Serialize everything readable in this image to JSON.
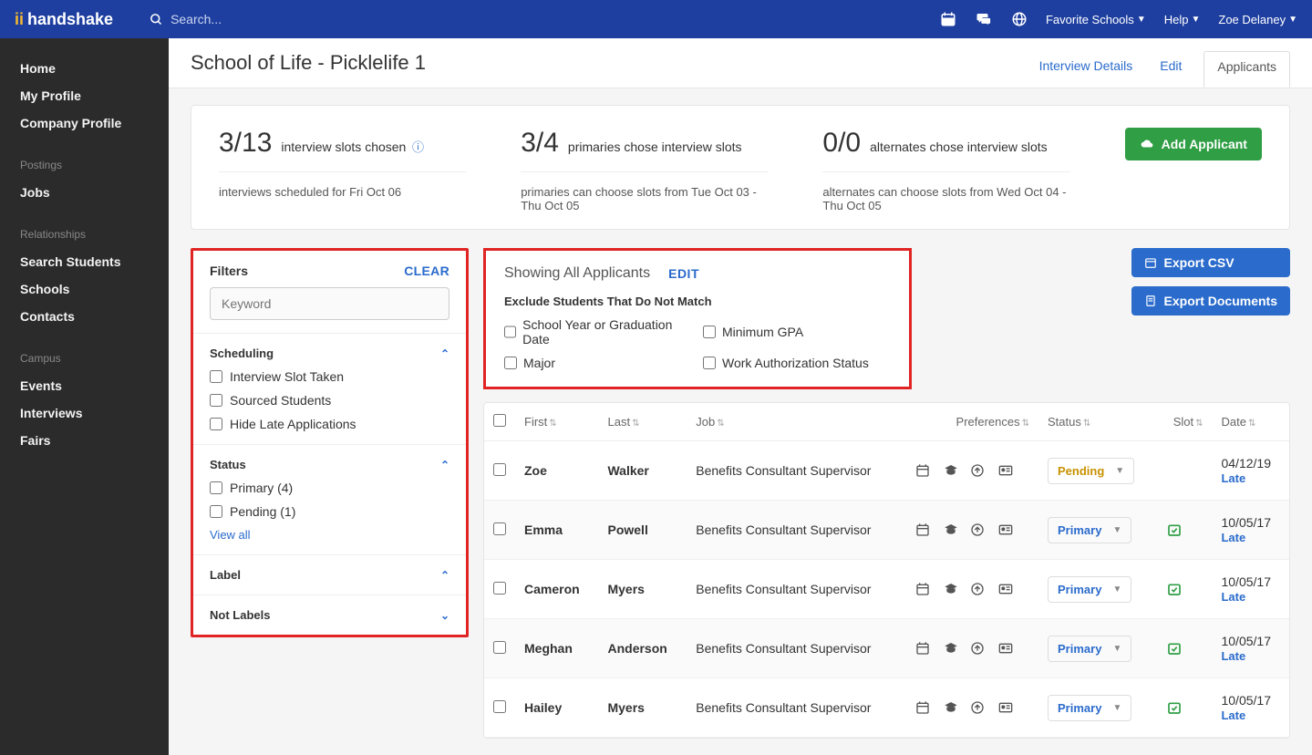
{
  "brand": {
    "name": "handshake"
  },
  "search": {
    "placeholder": "Search..."
  },
  "topnav": {
    "favorite_schools": "Favorite Schools",
    "help": "Help",
    "user": "Zoe Delaney"
  },
  "sidebar": {
    "groups": [
      {
        "title": null,
        "items": [
          "Home",
          "My Profile",
          "Company Profile"
        ]
      },
      {
        "title": "Postings",
        "items": [
          "Jobs"
        ]
      },
      {
        "title": "Relationships",
        "items": [
          "Search Students",
          "Schools",
          "Contacts"
        ]
      },
      {
        "title": "Campus",
        "items": [
          "Events",
          "Interviews",
          "Fairs"
        ]
      }
    ]
  },
  "page": {
    "title": "School of Life - Picklelife 1",
    "tabs": [
      "Interview Details",
      "Edit",
      "Applicants"
    ],
    "active_tab": 2
  },
  "stats": [
    {
      "num": "3/13",
      "label": "interview slots chosen",
      "info": true,
      "sub": "interviews scheduled for Fri Oct 06"
    },
    {
      "num": "3/4",
      "label": "primaries chose interview slots",
      "info": false,
      "sub": "primaries can choose slots from Tue Oct 03 - Thu Oct 05"
    },
    {
      "num": "0/0",
      "label": "alternates chose interview slots",
      "info": false,
      "sub": "alternates can choose slots from Wed Oct 04 - Thu Oct 05"
    }
  ],
  "add_applicant_label": "Add Applicant",
  "filters": {
    "title": "Filters",
    "clear": "CLEAR",
    "keyword_placeholder": "Keyword",
    "sections": {
      "scheduling": {
        "title": "Scheduling",
        "opts": [
          "Interview Slot Taken",
          "Sourced Students",
          "Hide Late Applications"
        ]
      },
      "status": {
        "title": "Status",
        "opts": [
          "Primary (4)",
          "Pending (1)"
        ],
        "view_all": "View all"
      },
      "label": {
        "title": "Label"
      },
      "not_labels": {
        "title": "Not Labels"
      }
    }
  },
  "applicants_filter": {
    "showing": "Showing All Applicants",
    "edit": "EDIT",
    "exclude_title": "Exclude Students That Do Not Match",
    "opts": [
      "School Year or Graduation Date",
      "Minimum GPA",
      "Major",
      "Work Authorization Status"
    ]
  },
  "export": {
    "csv": "Export CSV",
    "docs": "Export Documents"
  },
  "table": {
    "headers": {
      "first": "First",
      "last": "Last",
      "job": "Job",
      "prefs": "Preferences",
      "status": "Status",
      "slot": "Slot",
      "date": "Date"
    },
    "rows": [
      {
        "first": "Zoe",
        "last": "Walker",
        "job": "Benefits Consultant Supervisor",
        "status": "Pending",
        "status_class": "pending",
        "slot": false,
        "date": "04/12/19",
        "late": "Late"
      },
      {
        "first": "Emma",
        "last": "Powell",
        "job": "Benefits Consultant Supervisor",
        "status": "Primary",
        "status_class": "primary",
        "slot": true,
        "date": "10/05/17",
        "late": "Late"
      },
      {
        "first": "Cameron",
        "last": "Myers",
        "job": "Benefits Consultant Supervisor",
        "status": "Primary",
        "status_class": "primary",
        "slot": true,
        "date": "10/05/17",
        "late": "Late"
      },
      {
        "first": "Meghan",
        "last": "Anderson",
        "job": "Benefits Consultant Supervisor",
        "status": "Primary",
        "status_class": "primary",
        "slot": true,
        "date": "10/05/17",
        "late": "Late"
      },
      {
        "first": "Hailey",
        "last": "Myers",
        "job": "Benefits Consultant Supervisor",
        "status": "Primary",
        "status_class": "primary",
        "slot": true,
        "date": "10/05/17",
        "late": "Late"
      }
    ]
  }
}
